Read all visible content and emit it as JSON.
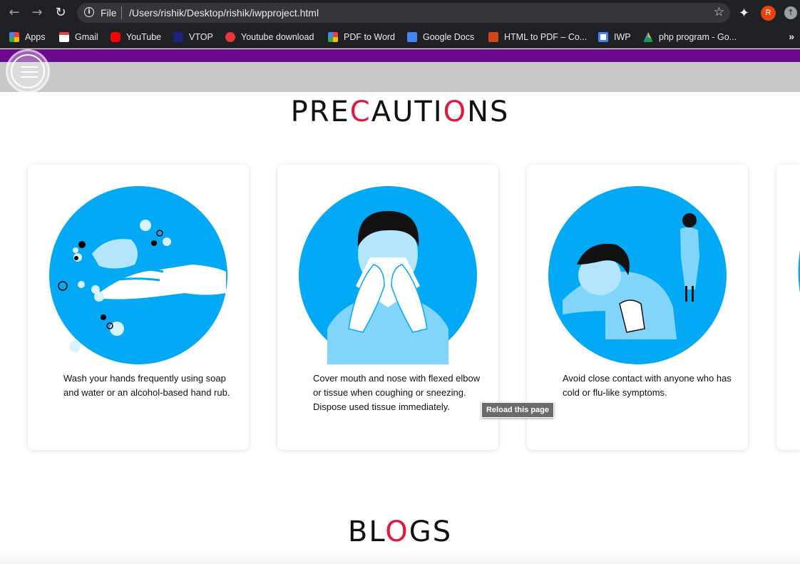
{
  "browser": {
    "scheme_label": "File",
    "url": "/Users/rishik/Desktop/rishik/iwpproject.html",
    "profile_initial": "R",
    "bookmarks": [
      {
        "label": "Apps",
        "color": "#4285f4"
      },
      {
        "label": "Gmail",
        "color": "#ea4335"
      },
      {
        "label": "YouTube",
        "color": "#ff0000"
      },
      {
        "label": "VTOP",
        "color": "#1a237e"
      },
      {
        "label": "Youtube download",
        "color": "#e53935"
      },
      {
        "label": "PDF to Word",
        "color": "#fbbc04"
      },
      {
        "label": "Google Docs",
        "color": "#4285f4"
      },
      {
        "label": "HTML to PDF – Co...",
        "color": "#d84315"
      },
      {
        "label": "IWP",
        "color": "#4285f4"
      },
      {
        "label": "php program - Go...",
        "color": "#0f9d58"
      }
    ],
    "more_label": "»"
  },
  "page": {
    "precautions_title": {
      "part1": "PRE",
      "red1": "C",
      "part2": "AUTI",
      "red2": "O",
      "part3": "NS"
    },
    "blogs_title": {
      "part1": "BL",
      "red1": "O",
      "part2": "GS"
    },
    "accent_color": "#e3173e",
    "header_strip_color": "#6a0a8e",
    "circle_color": "#03a9f4",
    "cards": [
      {
        "icon": "hand-washing-illustration",
        "text": "Wash your hands frequently using soap and water or an alcohol-based hand rub."
      },
      {
        "icon": "cover-mouth-illustration",
        "text": "Cover mouth and nose with flexed elbow or tissue when coughing or sneezing. Dispose used tissue immediately."
      },
      {
        "icon": "avoid-contact-illustration",
        "text": "Avoid close contact with anyone who has cold or flu-like symptoms."
      }
    ],
    "tooltip": "Reload this page"
  }
}
